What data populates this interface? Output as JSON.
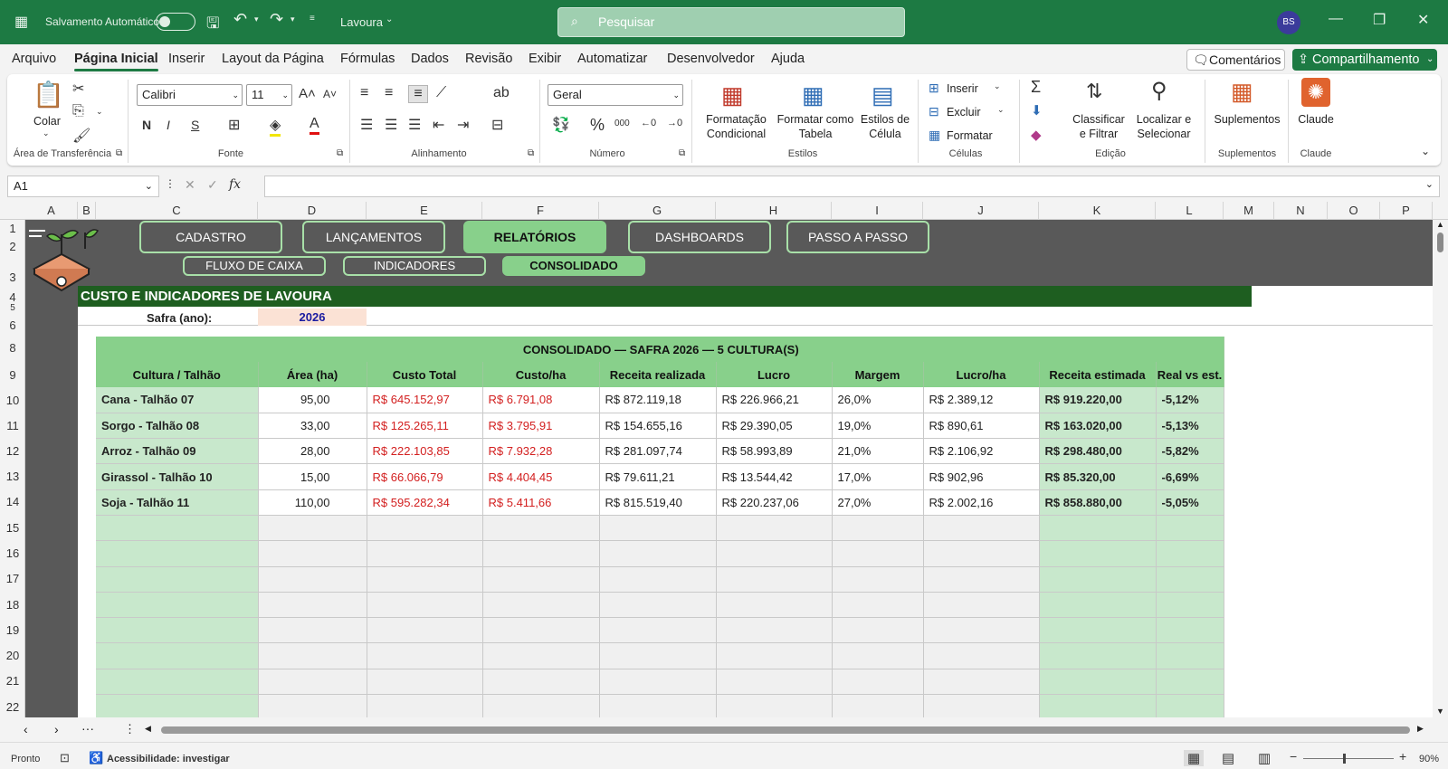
{
  "titlebar": {
    "autosave": "Salvamento Automático",
    "filename": "Lavoura",
    "search": "Pesquisar",
    "avatar": "BS"
  },
  "menu": {
    "items": [
      "Arquivo",
      "Página Inicial",
      "Inserir",
      "Layout da Página",
      "Fórmulas",
      "Dados",
      "Revisão",
      "Exibir",
      "Automatizar",
      "Desenvolvedor",
      "Ajuda"
    ],
    "comments": "Comentários",
    "share": "Compartilhamento"
  },
  "ribbon": {
    "clipboard": {
      "paste": "Colar",
      "label": "Área de Transferência"
    },
    "font": {
      "name": "Calibri",
      "size": "11",
      "label": "Fonte",
      "bold": "N",
      "italic": "I",
      "underline": "S"
    },
    "align": {
      "label": "Alinhamento"
    },
    "number": {
      "format": "Geral",
      "label": "Número"
    },
    "styles": {
      "cond": "Formatação Condicional",
      "table": "Formatar como Tabela",
      "cell": "Estilos de Célula",
      "label": "Estilos"
    },
    "cells": {
      "insert": "Inserir",
      "delete": "Excluir",
      "format": "Formatar",
      "label": "Células"
    },
    "editing": {
      "sort": "Classificar e Filtrar",
      "find": "Localizar e Selecionar",
      "label": "Edição"
    },
    "addins": {
      "btn": "Suplementos",
      "label": "Suplementos"
    },
    "claude": {
      "btn": "Claude",
      "label": "Claude"
    }
  },
  "formulabar": {
    "namebox": "A1",
    "fx": "fx"
  },
  "columns": [
    "A",
    "B",
    "C",
    "D",
    "E",
    "F",
    "G",
    "H",
    "I",
    "J",
    "K",
    "L",
    "M",
    "N",
    "O",
    "P"
  ],
  "rows": [
    "1",
    "2",
    "3",
    "4",
    "5",
    "6",
    "8",
    "9",
    "10",
    "11",
    "12",
    "13",
    "14",
    "15",
    "16",
    "17",
    "18",
    "19",
    "20",
    "21",
    "22"
  ],
  "nav": {
    "main": [
      "CADASTRO",
      "LANÇAMENTOS",
      "RELATÓRIOS",
      "DASHBOARDS",
      "PASSO A PASSO"
    ],
    "sub": [
      "FLUXO DE CAIXA",
      "INDICADORES",
      "CONSOLIDADO"
    ]
  },
  "banner": {
    "title": "CUSTO E INDICADORES DE LAVOURA",
    "safra_label": "Safra (ano):",
    "safra_value": "2026"
  },
  "table": {
    "caption": "CONSOLIDADO — SAFRA 2026 — 5 CULTURA(S)",
    "headers": [
      "Cultura / Talhão",
      "Área (ha)",
      "Custo Total",
      "Custo/ha",
      "Receita realizada",
      "Lucro",
      "Margem",
      "Lucro/ha",
      "Receita estimada",
      "Real vs est."
    ],
    "rows": [
      [
        "Cana - Talhão 07",
        "95,00",
        "R$ 645.152,97",
        "R$ 6.791,08",
        "R$ 872.119,18",
        "R$ 226.966,21",
        "26,0%",
        "R$ 2.389,12",
        "R$ 919.220,00",
        "-5,12%"
      ],
      [
        "Sorgo - Talhão 08",
        "33,00",
        "R$ 125.265,11",
        "R$ 3.795,91",
        "R$ 154.655,16",
        "R$ 29.390,05",
        "19,0%",
        "R$ 890,61",
        "R$ 163.020,00",
        "-5,13%"
      ],
      [
        "Arroz - Talhão 09",
        "28,00",
        "R$ 222.103,85",
        "R$ 7.932,28",
        "R$ 281.097,74",
        "R$ 58.993,89",
        "21,0%",
        "R$ 2.106,92",
        "R$ 298.480,00",
        "-5,82%"
      ],
      [
        "Girassol - Talhão 10",
        "15,00",
        "R$ 66.066,79",
        "R$ 4.404,45",
        "R$ 79.611,21",
        "R$ 13.544,42",
        "17,0%",
        "R$ 902,96",
        "R$ 85.320,00",
        "-6,69%"
      ],
      [
        "Soja - Talhão 11",
        "110,00",
        "R$ 595.282,34",
        "R$ 5.411,66",
        "R$ 815.519,40",
        "R$ 220.237,06",
        "27,0%",
        "R$ 2.002,16",
        "R$ 858.880,00",
        "-5,05%"
      ]
    ],
    "empty_rows": 8
  },
  "status": {
    "ready": "Pronto",
    "accessibility": "Acessibilidade: investigar",
    "zoom": "90%"
  }
}
